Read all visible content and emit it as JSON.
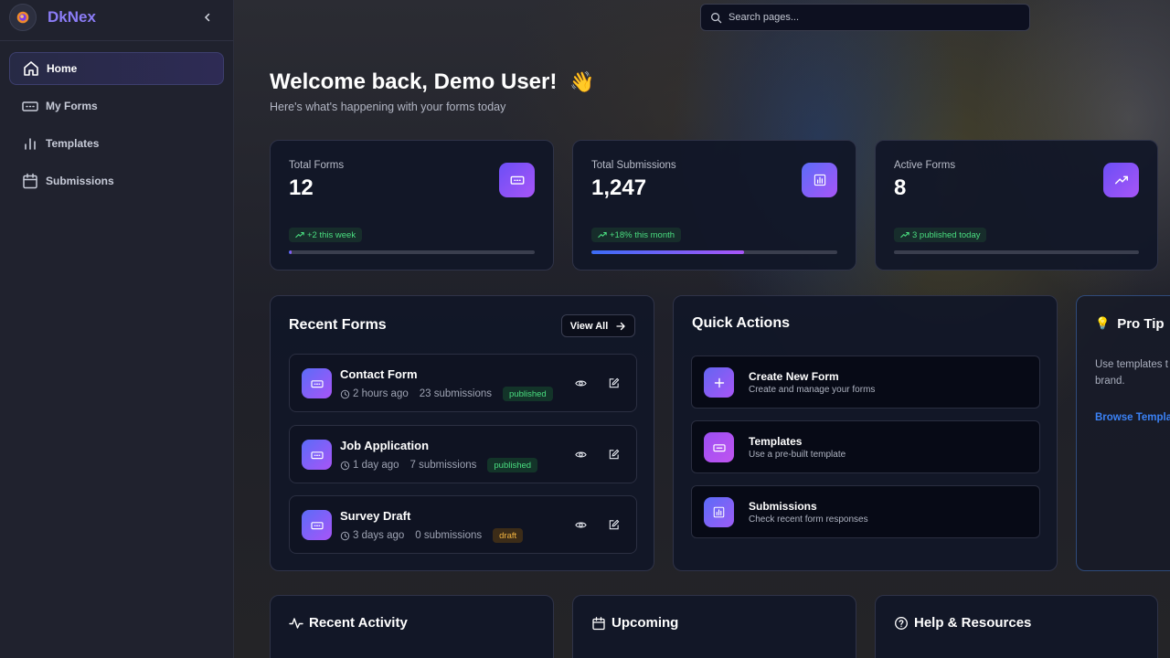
{
  "app": {
    "name": "DkNex"
  },
  "colors": {
    "accent": "#8b7cf6",
    "brand_gradient_start": "#5b6cf8",
    "brand_gradient_end": "#a855f7",
    "success": "#4ade80",
    "warning": "#f5b640",
    "link": "#3b82f6"
  },
  "sidebar": {
    "collapse_icon": "chevron-left-icon",
    "items": [
      {
        "label": "Home",
        "icon": "home-icon",
        "active": true
      },
      {
        "label": "My Forms",
        "icon": "form-icon",
        "active": false
      },
      {
        "label": "Templates",
        "icon": "bar-chart-icon",
        "active": false
      },
      {
        "label": "Submissions",
        "icon": "calendar-icon",
        "active": false
      }
    ]
  },
  "search": {
    "placeholder": "Search pages..."
  },
  "welcome": {
    "title": "Welcome back, Demo User!",
    "emoji": "👋",
    "subtitle": "Here's what's happening with your forms today"
  },
  "stats": [
    {
      "label": "Total Forms",
      "value": "12",
      "trend": "+2 this week",
      "progress": 0.01,
      "icon": "form-icon"
    },
    {
      "label": "Total Submissions",
      "value": "1,247",
      "trend": "+18% this month",
      "progress": 0.62,
      "icon": "bar-chart-icon"
    },
    {
      "label": "Active Forms",
      "value": "8",
      "trend": "3 published today",
      "progress": 0,
      "icon": "trending-up-icon"
    }
  ],
  "recent_forms": {
    "title": "Recent Forms",
    "view_all": "View All",
    "items": [
      {
        "name": "Contact Form",
        "time": "2 hours ago",
        "submissions": "23 submissions",
        "status": "published"
      },
      {
        "name": "Job Application",
        "time": "1 day ago",
        "submissions": "7 submissions",
        "status": "published"
      },
      {
        "name": "Survey Draft",
        "time": "3 days ago",
        "submissions": "0 submissions",
        "status": "draft"
      }
    ]
  },
  "quick_actions": {
    "title": "Quick Actions",
    "items": [
      {
        "title": "Create New Form",
        "subtitle": "Create and manage your forms",
        "icon": "plus-icon"
      },
      {
        "title": "Templates",
        "subtitle": "Use a pre-built template",
        "icon": "form-icon"
      },
      {
        "title": "Submissions",
        "subtitle": "Check recent form responses",
        "icon": "bar-chart-icon"
      }
    ]
  },
  "pro_tip": {
    "title": "Pro Tip",
    "icon": "lightbulb-icon",
    "text": "Use templates t includes all the brand.",
    "link": "Browse Templa"
  },
  "bottom": {
    "activity": "Recent Activity",
    "upcoming": "Upcoming",
    "help": "Help & Resources"
  }
}
